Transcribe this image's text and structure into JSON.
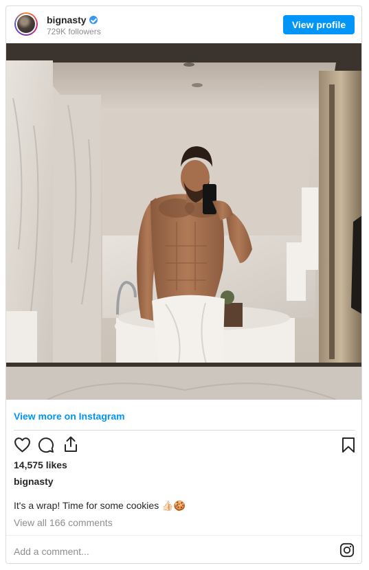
{
  "header": {
    "username": "bignasty",
    "followers": "729K followers",
    "view_profile_label": "View profile",
    "verified_icon": "verified-badge-icon"
  },
  "photo": {
    "description_icon": "photo"
  },
  "view_more_label": "View more on Instagram",
  "actions": {
    "like_icon": "heart-icon",
    "comment_icon": "comment-icon",
    "share_icon": "share-icon",
    "save_icon": "bookmark-icon"
  },
  "likes": "14,575 likes",
  "post_username": "bignasty",
  "caption": "It's a wrap! Time for some cookies 👍🏻🍪",
  "view_comments": "View all 166 comments",
  "comment": {
    "placeholder": "Add a comment...",
    "instagram_icon": "instagram-icon"
  },
  "colors": {
    "accent": "#0095f6",
    "text": "#262626",
    "muted": "#8e8e8e",
    "border": "#dbdbdb"
  }
}
